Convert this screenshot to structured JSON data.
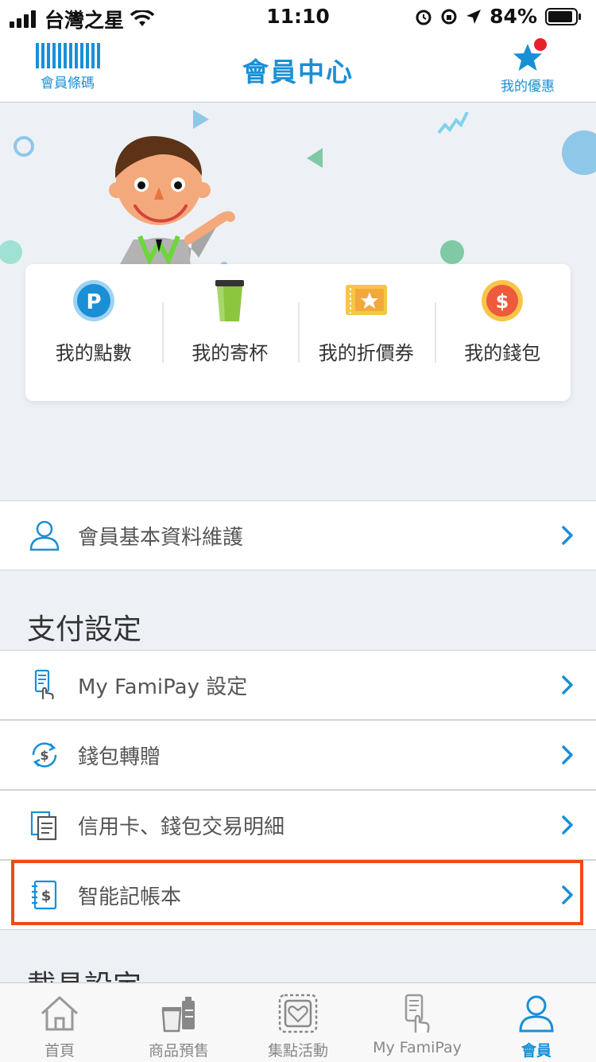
{
  "status_bar": {
    "carrier": "台灣之星",
    "time": "11:10",
    "battery": "84%"
  },
  "header": {
    "title": "會員中心",
    "left_label": "會員條碼",
    "right_label": "我的優惠"
  },
  "quick_links": [
    {
      "label": "我的點數",
      "icon": "points-icon"
    },
    {
      "label": "我的寄杯",
      "icon": "cup-icon"
    },
    {
      "label": "我的折價券",
      "icon": "coupon-icon"
    },
    {
      "label": "我的錢包",
      "icon": "wallet-icon"
    }
  ],
  "member_row": {
    "label": "會員基本資料維護",
    "icon": "person-icon"
  },
  "payment_section": {
    "title": "支付設定",
    "items": [
      {
        "label": "My FamiPay 設定",
        "icon": "phone-tap-icon"
      },
      {
        "label": "錢包轉贈",
        "icon": "transfer-icon"
      },
      {
        "label": "信用卡、錢包交易明細",
        "icon": "document-icon"
      },
      {
        "label": "智能記帳本",
        "icon": "ledger-icon"
      }
    ]
  },
  "next_section": {
    "title": "載具設定"
  },
  "tabs": [
    {
      "label": "首頁",
      "icon": "home-icon",
      "active": false
    },
    {
      "label": "商品預售",
      "icon": "presale-icon",
      "active": false
    },
    {
      "label": "集點活動",
      "icon": "stamp-icon",
      "active": false
    },
    {
      "label": "My FamiPay",
      "icon": "famipay-icon",
      "active": false
    },
    {
      "label": "會員",
      "icon": "member-icon",
      "active": true
    }
  ],
  "colors": {
    "accent": "#1a8fd6",
    "highlight": "#f04a16",
    "background": "#edf1f6"
  }
}
